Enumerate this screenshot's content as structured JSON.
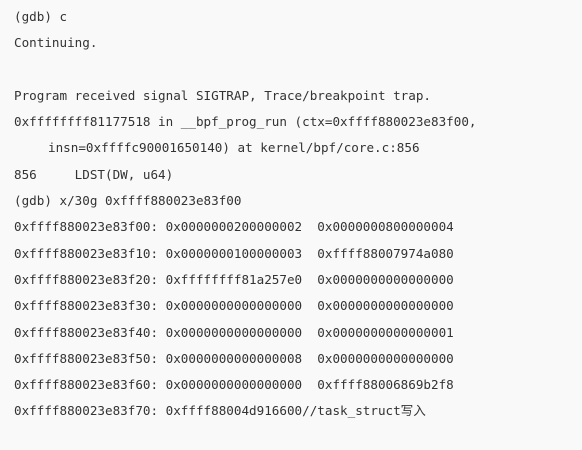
{
  "terminal": {
    "lines": [
      "(gdb) c",
      "Continuing.",
      "",
      "Program received signal SIGTRAP, Trace/breakpoint trap.",
      "0xffffffff81177518 in __bpf_prog_run (ctx=0xffff880023e83f00,",
      "insn=0xffffc90001650140) at kernel/bpf/core.c:856",
      "856     LDST(DW, u64)",
      "(gdb) x/30g 0xffff880023e83f00",
      "0xffff880023e83f00: 0x0000000200000002  0x0000000800000004",
      "0xffff880023e83f10: 0x0000000100000003  0xffff88007974a080",
      "0xffff880023e83f20: 0xffffffff81a257e0  0x0000000000000000",
      "0xffff880023e83f30: 0x0000000000000000  0x0000000000000000",
      "0xffff880023e83f40: 0x0000000000000000  0x0000000000000001",
      "0xffff880023e83f50: 0x0000000000000008  0x0000000000000000",
      "0xffff880023e83f60: 0x0000000000000000  0xffff88006869b2f8",
      "0xffff880023e83f70: 0xffff88004d916600//task_struct写入"
    ]
  }
}
